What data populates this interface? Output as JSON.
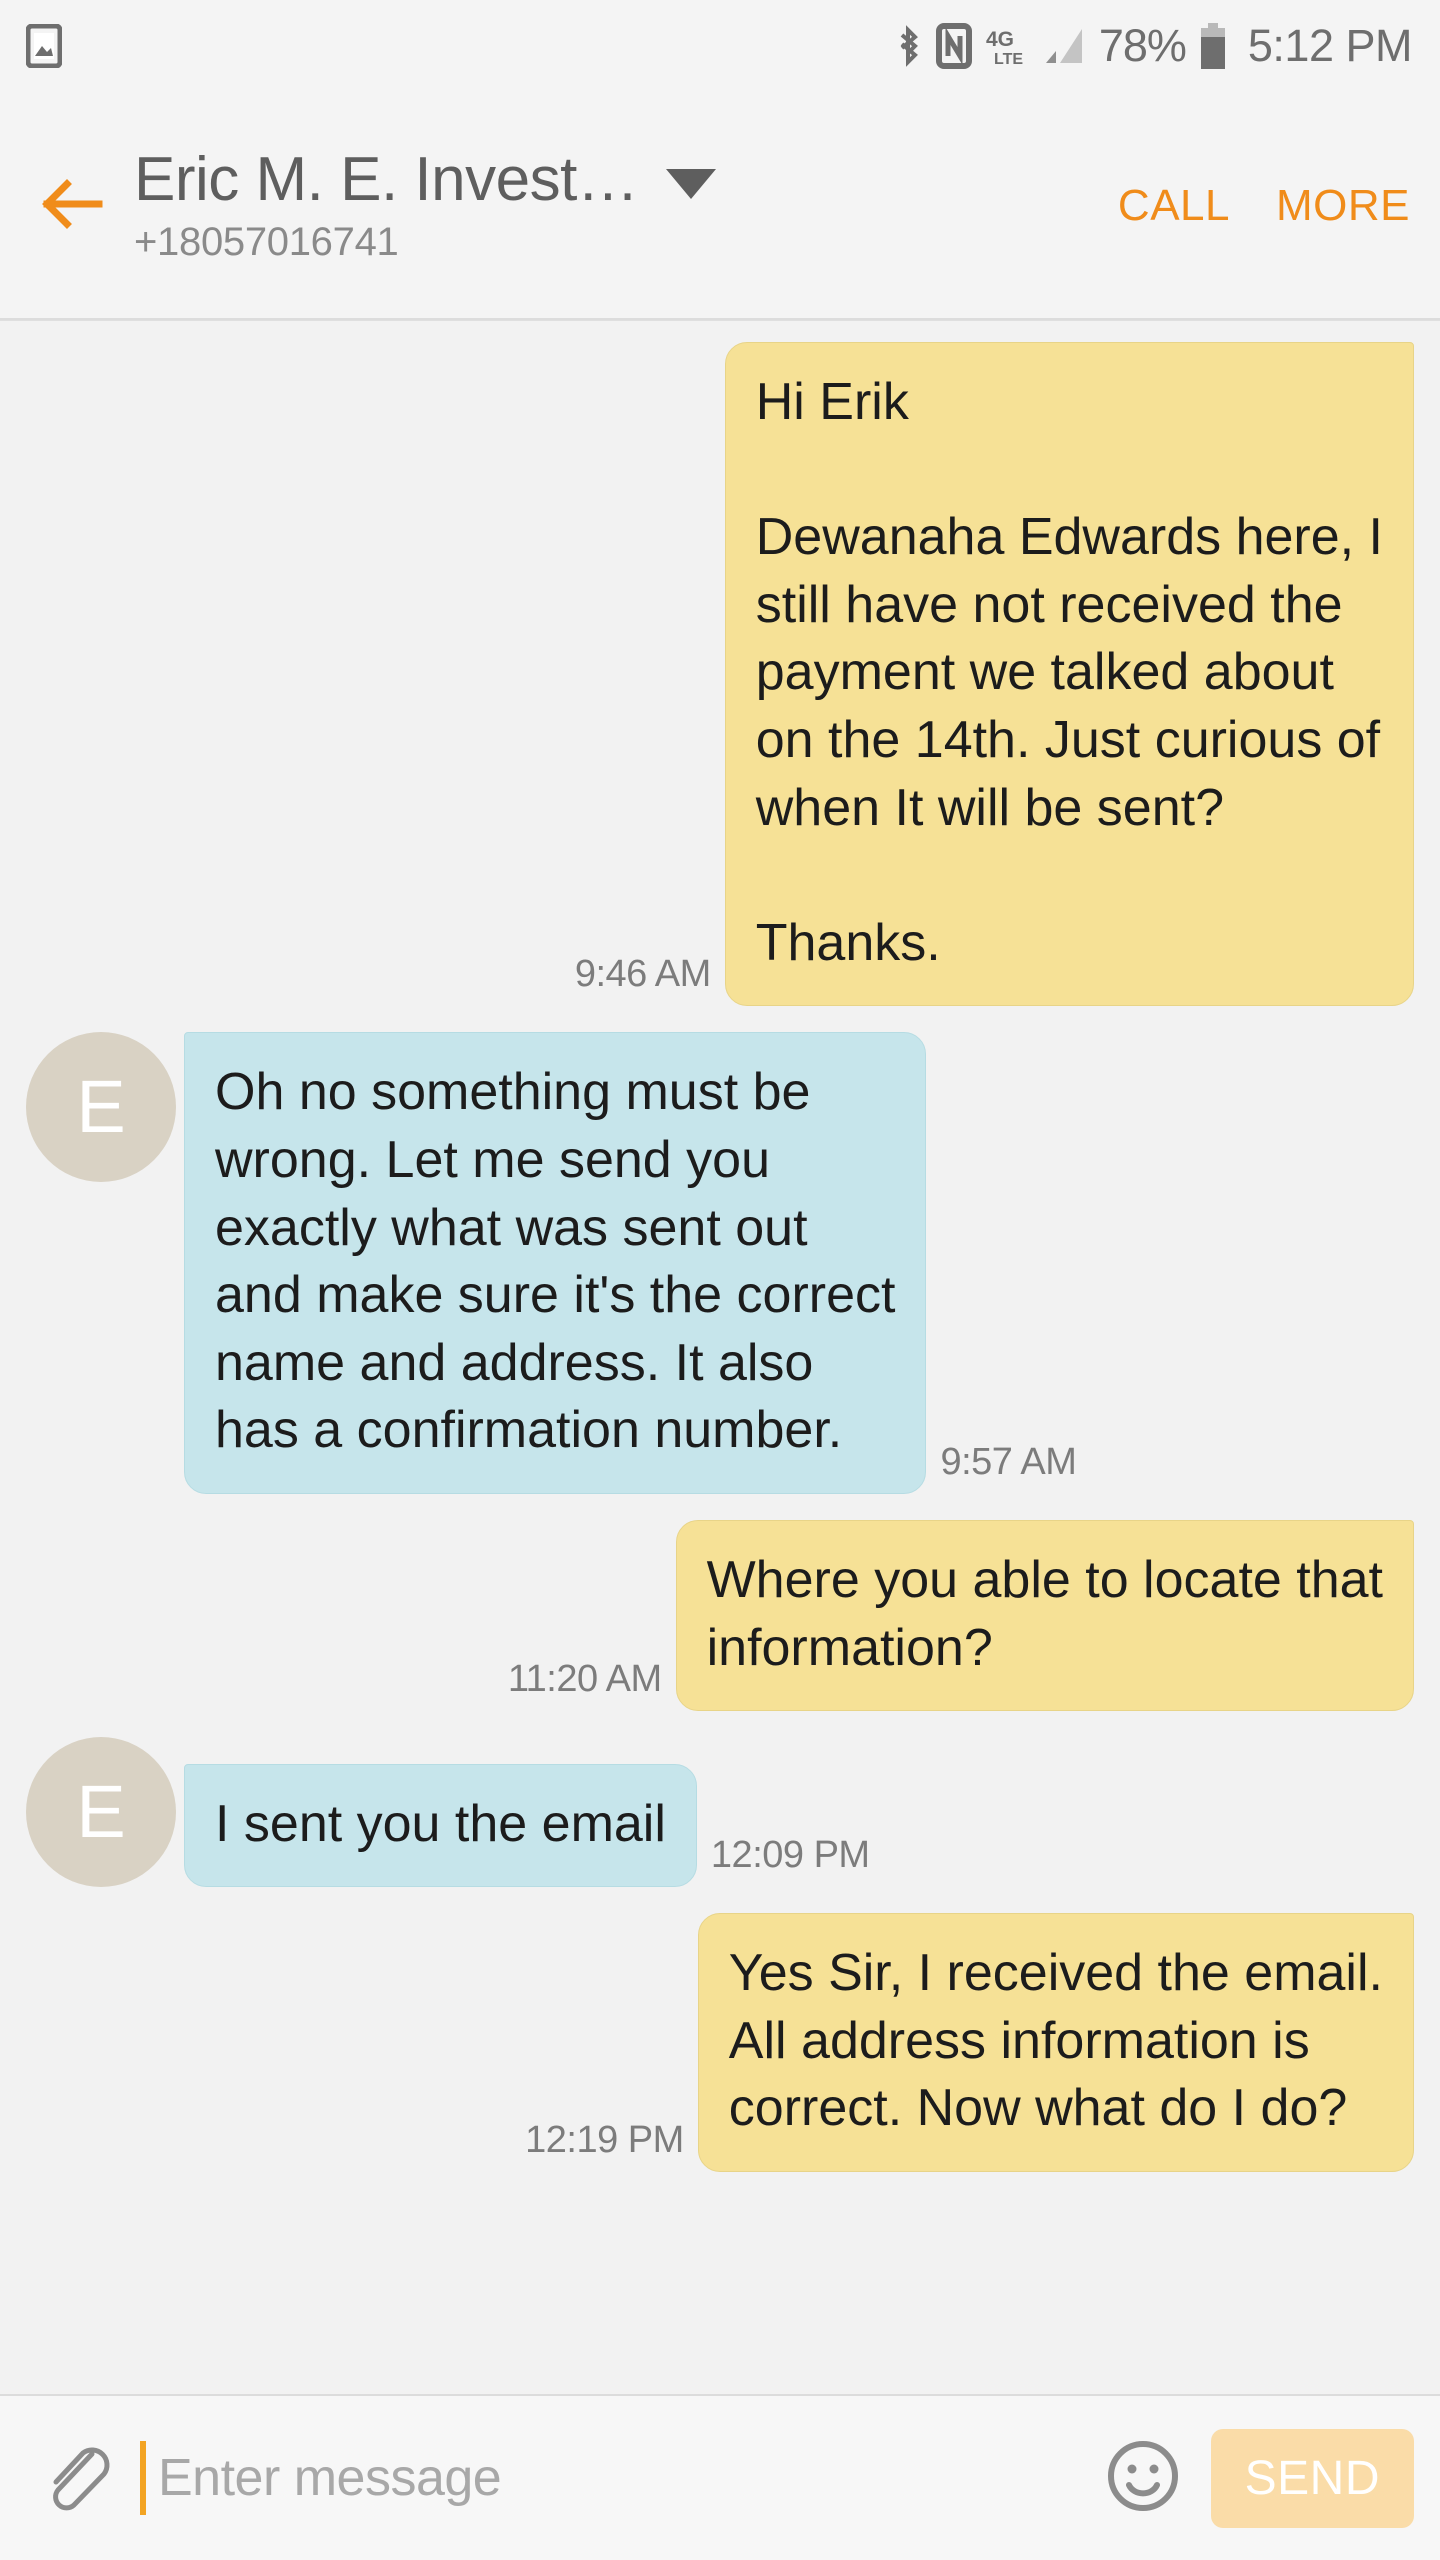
{
  "status_bar": {
    "left_icons": [
      {
        "name": "gallery-icon"
      }
    ],
    "right_icons": [
      {
        "name": "bluetooth-icon"
      },
      {
        "name": "nfc-icon"
      },
      {
        "name": "4g-lte-icon",
        "label": "4G LTE"
      },
      {
        "name": "signal-bars-icon"
      }
    ],
    "battery_percent": "78%",
    "time": "5:12 PM"
  },
  "header": {
    "back_label": "back-arrow",
    "contact_name": "Eric M. E. Invest…",
    "contact_number": "+18057016741",
    "call_label": "CALL",
    "more_label": "MORE",
    "accent_color": "#F08C1A"
  },
  "thread": {
    "messages": [
      {
        "direction": "out",
        "text": "Hi Erik\n\nDewanaha Edwards here, I\nstill have not received the\npayment we talked about\non the 14th. Just curious of\nwhen It will be sent?\n\nThanks.",
        "time": "9:46 AM",
        "avatar": null
      },
      {
        "direction": "in",
        "text": "Oh no something must be\nwrong. Let me send you\nexactly what was sent out\nand make sure it's the correct\nname and address. It also\nhas a confirmation number.",
        "time": "9:57 AM",
        "avatar": "E"
      },
      {
        "direction": "out",
        "text": "Where you able to locate that\ninformation?",
        "time": "11:20 AM",
        "avatar": null
      },
      {
        "direction": "in",
        "text": "I sent you the email",
        "time": "12:09 PM",
        "avatar": "E"
      },
      {
        "direction": "out",
        "text": "Yes Sir, I received the email.\nAll address information is\ncorrect. Now what do I do?",
        "time": "12:19 PM",
        "avatar": null
      }
    ],
    "bubble_out_color": "#F6E196",
    "bubble_in_color": "#C6E5EB",
    "avatar_color": "#D9D2C4"
  },
  "composer": {
    "attach_icon": "paperclip-icon",
    "input_value": "",
    "placeholder": "Enter message",
    "emoji_icon": "smiley-icon",
    "send_label": "SEND"
  }
}
